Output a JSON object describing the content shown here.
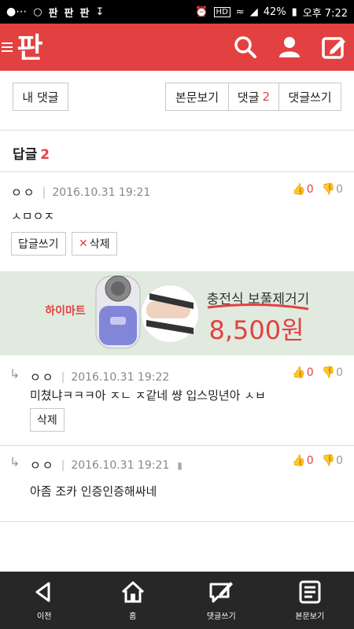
{
  "statusbar": {
    "battery_pct": "42%",
    "time": "오후 7:22",
    "hd": "HD"
  },
  "app": {
    "logo": "판"
  },
  "toolbar": {
    "my_comments": "내 댓글",
    "view_post": "본문보기",
    "comments_label": "댓글",
    "comments_count": "2",
    "write_comment": "댓글쓰기"
  },
  "replies": {
    "title": "답글",
    "count": "2"
  },
  "comments": [
    {
      "author": "ㅇㅇ",
      "date": "2016.10.31 19:21",
      "text": "ㅅㅁㅇㅈ",
      "up": "0",
      "down": "0",
      "reply_btn": "답글쓰기",
      "delete_btn": "삭제"
    },
    {
      "author": "ㅇㅇ",
      "date": "2016.10.31 19:22",
      "text": "미쳤냐ㅋㅋㅋ아 ㅈㄴ ㅈ같네 썅 입스밍년아 ㅅㅂ",
      "up": "0",
      "down": "0",
      "delete_btn": "삭제"
    },
    {
      "author": "ㅇㅇ",
      "date": "2016.10.31 19:21",
      "text": "아좀 조카 인증인증해싸네",
      "up": "0",
      "down": "0"
    }
  ],
  "ad": {
    "brand": "하이마트",
    "product": "충전식 보풀제거기",
    "price": "8,500원"
  },
  "bottom_nav": [
    {
      "label": "이전",
      "icon": "back-icon"
    },
    {
      "label": "홈",
      "icon": "home-icon"
    },
    {
      "label": "댓글쓰기",
      "icon": "comment-write-icon"
    },
    {
      "label": "본문보기",
      "icon": "document-icon"
    }
  ],
  "colors": {
    "brand": "#e34141",
    "nav": "#272727",
    "ad_bg": "#e1eadf"
  }
}
